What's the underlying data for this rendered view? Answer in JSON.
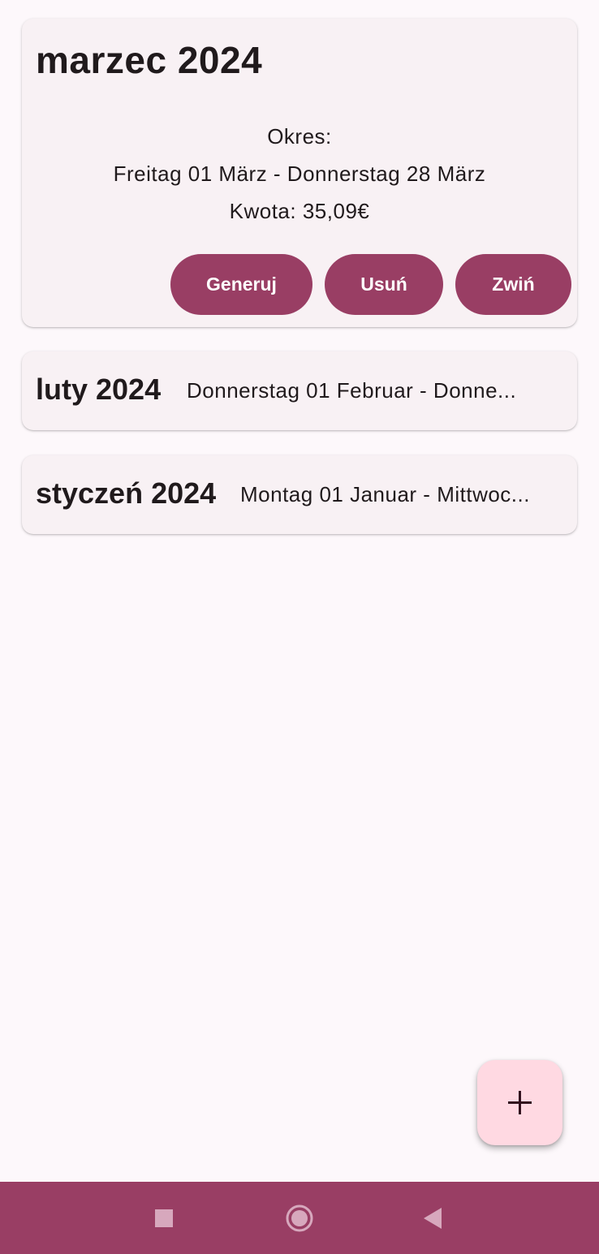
{
  "cards": {
    "expanded": {
      "title": "marzec 2024",
      "period_label": "Okres:",
      "period_range": "Freitag 01 März - Donnerstag 28 März",
      "amount": "Kwota: 35,09€",
      "buttons": {
        "generate": "Generuj",
        "delete": "Usuń",
        "collapse": "Zwiń"
      }
    },
    "collapsed": [
      {
        "title": "luty 2024",
        "range": "Donnerstag 01 Februar - Donne..."
      },
      {
        "title": "styczeń 2024",
        "range": "Montag 01 Januar - Mittwoc..."
      }
    ]
  },
  "fab": {
    "icon": "plus-icon"
  },
  "nav_bar": {
    "icons": [
      "recents-square-icon",
      "home-circle-icon",
      "back-triangle-icon"
    ]
  },
  "colors": {
    "accent": "#993e64",
    "fab_bg": "#ffd9e2",
    "card_bg": "#f8f1f4",
    "page_bg": "#fdf8fb"
  }
}
